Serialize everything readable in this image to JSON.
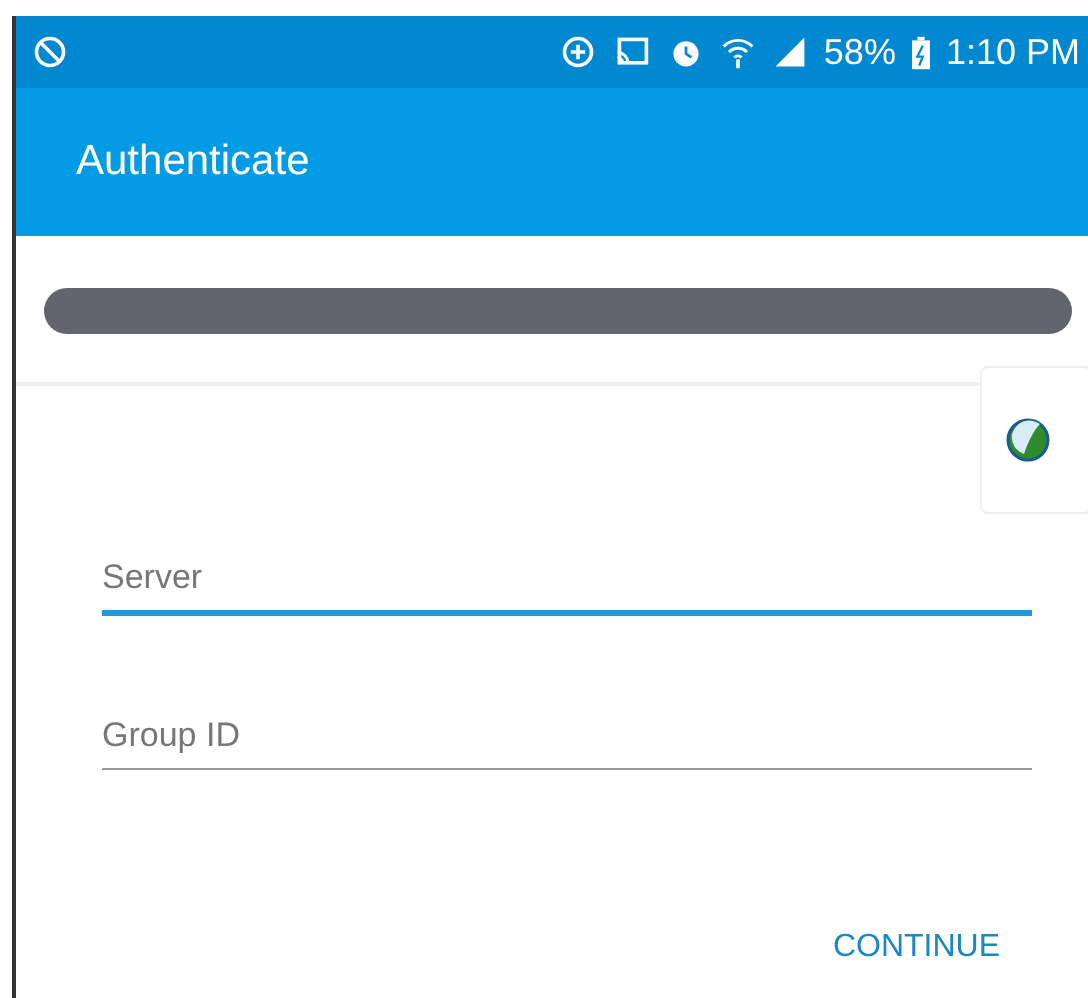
{
  "status_bar": {
    "battery": "58%",
    "time": "1:10 PM"
  },
  "app_bar": {
    "title": "Authenticate"
  },
  "fields": [
    {
      "placeholder": "Server",
      "focused": true
    },
    {
      "placeholder": "Group ID",
      "focused": false
    }
  ],
  "buttons": [
    {
      "label": "CONTINUE"
    }
  ]
}
